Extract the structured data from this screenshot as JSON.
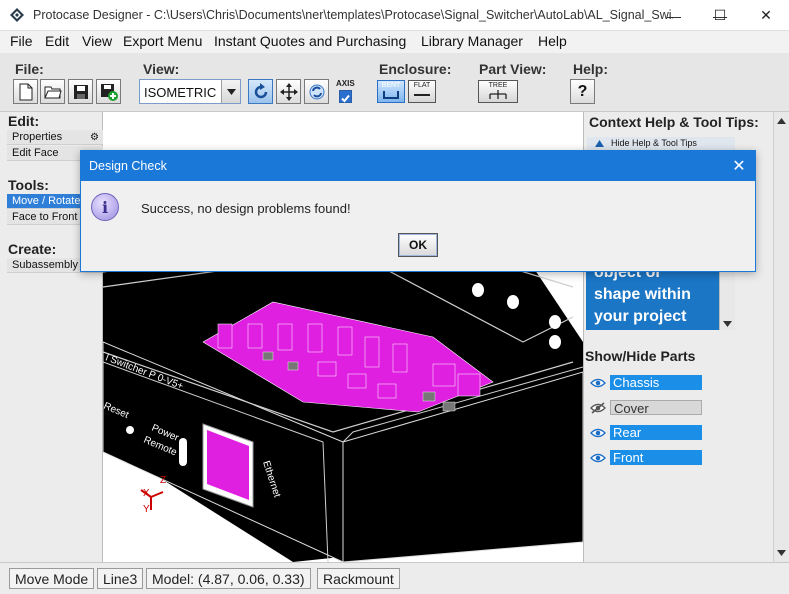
{
  "window": {
    "title": "Protocase Designer - C:\\Users\\Chris\\Documents\\ner\\templates\\Protocase\\Signal_Switcher\\AutoLab\\AL_Signal_Swi...",
    "minimize": "—",
    "maximize": "☐",
    "close": "✕"
  },
  "menubar": {
    "items": [
      "File",
      "Edit",
      "View",
      "Export Menu",
      "Instant Quotes and Purchasing",
      "Library Manager",
      "Help"
    ]
  },
  "toolbar": {
    "file_label": "File:",
    "view_label": "View:",
    "view_value": "ISOMETRIC",
    "axis_label": "AXIS",
    "enclosure_label": "Enclosure:",
    "bent_label": "BENT",
    "flat_label": "FLAT",
    "part_view_label": "Part View:",
    "tree_label": "TREE",
    "help_label": "Help:",
    "help_button": "?"
  },
  "left_panel": {
    "edit_label": "Edit:",
    "properties": "Properties",
    "edit_face": "Edit Face",
    "tools_label": "Tools:",
    "move_rotate": "Move / Rotate",
    "face_to_front": "Face to Front",
    "create_label": "Create:",
    "subassembly": "Subassembly"
  },
  "right_panel": {
    "title": "Context Help & Tool Tips:",
    "hide_help": "Hide Help & Tool Tips",
    "help_text_lines": [
      "object or",
      "shape within",
      "your project"
    ],
    "show_hide_label": "Show/Hide Parts",
    "parts": [
      {
        "name": "Chassis",
        "visible": true
      },
      {
        "name": "Cover",
        "visible": false
      },
      {
        "name": "Rear",
        "visible": true
      },
      {
        "name": "Front",
        "visible": true
      }
    ]
  },
  "canvas": {
    "panel_text_1": "l Switcher P 0-V5+",
    "panel_text_reset": "Reset",
    "panel_text_power": "Power",
    "panel_text_remote": "Remote",
    "panel_text_ethernet": "Ethernet",
    "axis_z": "Z",
    "axis_x": "X",
    "axis_y": "Y"
  },
  "statusbar": {
    "mode": "Move Mode",
    "line": "Line3",
    "model": "Model: (4.87, 0.06, 0.33)",
    "type": "Rackmount"
  },
  "dialog": {
    "title": "Design Check",
    "close": "✕",
    "message": "Success, no design problems found!",
    "ok": "OK",
    "info_glyph": "i"
  },
  "colors": {
    "accent": "#1a78d8",
    "pcb": "#e020e0",
    "part_on": "#1b8ee8"
  }
}
